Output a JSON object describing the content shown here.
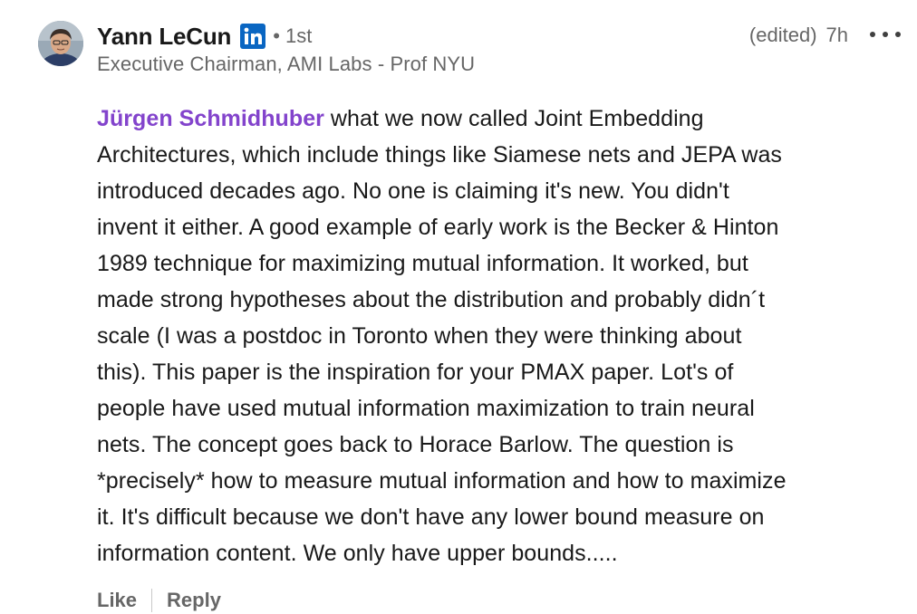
{
  "comment": {
    "author": {
      "name": "Yann LeCun",
      "connection_degree": "1st",
      "degree_separator": "•",
      "headline": "Executive Chairman, AMI Labs - Prof NYU"
    },
    "edited_label": "(edited)",
    "timestamp": "7h",
    "mention": "Jürgen Schmidhuber",
    "body_lines": [
      " what we now called Joint Embedding",
      "Architectures, which include things like Siamese nets and JEPA was",
      "introduced decades ago. No one is claiming it's new. You didn't",
      "invent it either. A good example of early work is the Becker & Hinton",
      "1989 technique for maximizing mutual information. It worked, but",
      "made strong hypotheses about the distribution and probably didn´t",
      "scale (I was a postdoc in Toronto when they were thinking about",
      "this). This paper is the inspiration for your PMAX paper. Lot's of",
      "people have used mutual information maximization to train neural",
      "nets. The concept goes back to Horace Barlow. The question is",
      "*precisely* how to measure mutual information and how to maximize",
      "it. It's difficult because we don't have any lower bound measure on",
      "information content. We only have upper bounds....."
    ],
    "actions": {
      "like": "Like",
      "reply": "Reply"
    },
    "icons": {
      "linkedin_badge": "linkedin-icon",
      "more": "more-options-icon"
    },
    "colors": {
      "mention": "#8344cc",
      "linkedin_blue": "#0a66c2",
      "secondary_text": "#666666",
      "primary_text": "#191919"
    }
  }
}
